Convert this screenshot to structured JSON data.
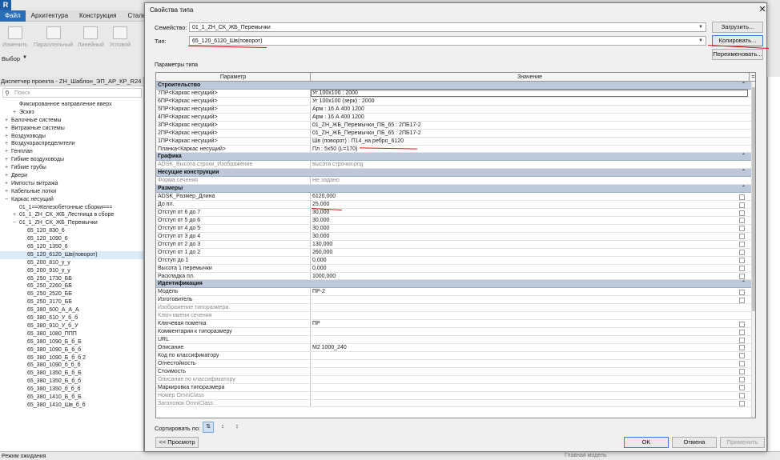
{
  "app": {
    "logo": "R",
    "menu": [
      "Файл",
      "Архитектура",
      "Конструкция",
      "Сталь"
    ],
    "ribbon_tools": [
      "Изменить",
      "Параллельный",
      "Линейный",
      "Угловой"
    ],
    "selection_label": "Выбор",
    "browser_title": "Диспетчер проекта - ZH_Шаблон_ЭП_АР_КР_R24",
    "browser_search_placeholder": "Поиск",
    "tree": [
      {
        "indent": 2,
        "exp": "",
        "label": "Фиксированное направление вверх"
      },
      {
        "indent": 2,
        "exp": "+",
        "label": "Эскиз"
      },
      {
        "indent": 1,
        "exp": "+",
        "label": "Балочные системы"
      },
      {
        "indent": 1,
        "exp": "+",
        "label": "Витражные системы"
      },
      {
        "indent": 1,
        "exp": "+",
        "label": "Воздуховоды"
      },
      {
        "indent": 1,
        "exp": "+",
        "label": "Воздухораспределители"
      },
      {
        "indent": 1,
        "exp": "+",
        "label": "Генплан"
      },
      {
        "indent": 1,
        "exp": "+",
        "label": "Гибкие воздуховоды"
      },
      {
        "indent": 1,
        "exp": "+",
        "label": "Гибкие трубы"
      },
      {
        "indent": 1,
        "exp": "+",
        "label": "Двери"
      },
      {
        "indent": 1,
        "exp": "+",
        "label": "Импосты витража"
      },
      {
        "indent": 1,
        "exp": "+",
        "label": "Кабельные лотки"
      },
      {
        "indent": 1,
        "exp": "−",
        "label": "Каркас несущий"
      },
      {
        "indent": 2,
        "exp": "",
        "label": "01_1==Железобетонные сборки==="
      },
      {
        "indent": 2,
        "exp": "+",
        "label": "01_1_ZH_СК_ЖБ_Лестница в сборе"
      },
      {
        "indent": 2,
        "exp": "−",
        "label": "01_1_ZH_СК_ЖБ_Перемычки"
      },
      {
        "indent": 3,
        "exp": "",
        "label": "65_120_830_6"
      },
      {
        "indent": 3,
        "exp": "",
        "label": "65_120_1090_6"
      },
      {
        "indent": 3,
        "exp": "",
        "label": "65_120_1350_6"
      },
      {
        "indent": 3,
        "exp": "",
        "label": "65_120_6120_Шв(поворот)",
        "selected": true
      },
      {
        "indent": 3,
        "exp": "",
        "label": "65_200_810_у_у"
      },
      {
        "indent": 3,
        "exp": "",
        "label": "65_200_910_у_у"
      },
      {
        "indent": 3,
        "exp": "",
        "label": "65_250_1730_ББ"
      },
      {
        "indent": 3,
        "exp": "",
        "label": "65_250_2260_ББ"
      },
      {
        "indent": 3,
        "exp": "",
        "label": "65_250_2520_ББ"
      },
      {
        "indent": 3,
        "exp": "",
        "label": "65_250_3170_ББ"
      },
      {
        "indent": 3,
        "exp": "",
        "label": "65_380_600_А_А_А"
      },
      {
        "indent": 3,
        "exp": "",
        "label": "65_380_610_У_б_б"
      },
      {
        "indent": 3,
        "exp": "",
        "label": "65_380_910_У_б_У"
      },
      {
        "indent": 3,
        "exp": "",
        "label": "65_380_1080_ППП"
      },
      {
        "indent": 3,
        "exp": "",
        "label": "65_380_1090_Б_б_Б"
      },
      {
        "indent": 3,
        "exp": "",
        "label": "65_380_1090_Б_б_б"
      },
      {
        "indent": 3,
        "exp": "",
        "label": "65_380_1090_Б_б_б 2"
      },
      {
        "indent": 3,
        "exp": "",
        "label": "65_380_1090_б_б_б"
      },
      {
        "indent": 3,
        "exp": "",
        "label": "65_380_1350_Б_б_Б"
      },
      {
        "indent": 3,
        "exp": "",
        "label": "65_380_1350_Б_б_б"
      },
      {
        "indent": 3,
        "exp": "",
        "label": "65_380_1350_б_б_б"
      },
      {
        "indent": 3,
        "exp": "",
        "label": "65_380_1410_Б_б_Б"
      },
      {
        "indent": 3,
        "exp": "",
        "label": "65_380_1410_Шв_б_б"
      }
    ],
    "status_text": "Режим ожидания",
    "status_model": "Главная модель"
  },
  "dialog": {
    "title": "Свойства типа",
    "family_label": "Семейство:",
    "family_value": "01_1_ZH_СК_ЖБ_Перемычки",
    "type_label": "Тип:",
    "type_value": "65_120_6120_Шв(поворот)",
    "load_button": "Загрузить...",
    "copy_button": "Копировать...",
    "rename_button": "Переименовать...",
    "params_label": "Параметры типа",
    "col_param": "Параметр",
    "col_value": "Значение",
    "col_extra": "=",
    "rows": [
      {
        "kind": "group",
        "param": "Строительство"
      },
      {
        "kind": "row",
        "param": "7ПР<Каркас несущий>",
        "value": "Уг 100х100 : 2000",
        "edit": true
      },
      {
        "kind": "row",
        "param": "6ПР<Каркас несущий>",
        "value": "Уг 100х100 (зерк) : 2000"
      },
      {
        "kind": "row",
        "param": "5ПР<Каркас несущий>",
        "value": "Арм : 16 А 400 1200"
      },
      {
        "kind": "row",
        "param": "4ПР<Каркас несущий>",
        "value": "Арм : 16 А 400 1200"
      },
      {
        "kind": "row",
        "param": "3ПР<Каркас несущий>",
        "value": "01_ZH_ЖБ_Перемычки_ПБ_65 : 2ПБ17-2"
      },
      {
        "kind": "row",
        "param": "2ПР<Каркас несущий>",
        "value": "01_ZH_ЖБ_Перемычки_ПБ_65 : 2ПБ17-2"
      },
      {
        "kind": "row",
        "param": "1ПР<Каркас несущий>",
        "value": "Шв (поворот) : П14_на ребро_6120"
      },
      {
        "kind": "row",
        "param": "Планка<Каркас несущий>",
        "value": "Пл : 5х50 (L=170)"
      },
      {
        "kind": "group",
        "param": "Графика"
      },
      {
        "kind": "row",
        "dim": true,
        "param": "ADSK_Высота строки_Изображение",
        "value": "высота строчки.png"
      },
      {
        "kind": "group",
        "param": "Несущие конструкции"
      },
      {
        "kind": "row",
        "dim": true,
        "param": "Форма сечения",
        "value": "Не задано"
      },
      {
        "kind": "group",
        "param": "Размеры"
      },
      {
        "kind": "row",
        "param": "ADSK_Размер_Длина",
        "value": "6120,000",
        "chk": true
      },
      {
        "kind": "row",
        "param": "До пл.",
        "value": "25,000",
        "chk": true
      },
      {
        "kind": "row",
        "param": "Отступ от 6 до 7",
        "value": "30,000",
        "chk": true
      },
      {
        "kind": "row",
        "param": "Отступ от 5 до 6",
        "value": "30,000",
        "chk": true
      },
      {
        "kind": "row",
        "param": "Отступ от 4 до 5",
        "value": "30,000",
        "chk": true
      },
      {
        "kind": "row",
        "param": "Отступ от 3 до 4",
        "value": "30,000",
        "chk": true
      },
      {
        "kind": "row",
        "param": "Отступ от 2 до 3",
        "value": "130,000",
        "chk": true
      },
      {
        "kind": "row",
        "param": "Отступ от 1 до 2",
        "value": "260,000",
        "chk": true
      },
      {
        "kind": "row",
        "param": "Отступ до 1",
        "value": "0,000",
        "chk": true
      },
      {
        "kind": "row",
        "param": "Высота 1 перемычки",
        "value": "0,000",
        "chk": true
      },
      {
        "kind": "row",
        "param": "Раскладка пл.",
        "value": "1000,000",
        "chk": true
      },
      {
        "kind": "group",
        "param": "Идентификация"
      },
      {
        "kind": "row",
        "param": "Модель",
        "value": "ПР-2",
        "chk": true
      },
      {
        "kind": "row",
        "param": "Изготовитель",
        "value": "",
        "chk": true
      },
      {
        "kind": "row",
        "dim": true,
        "param": "Изображение типоразмера",
        "value": ""
      },
      {
        "kind": "row",
        "dim": true,
        "param": "Ключ имени сечения",
        "value": ""
      },
      {
        "kind": "row",
        "param": "Ключевая пометка",
        "value": "ПР",
        "chk": true
      },
      {
        "kind": "row",
        "param": "Комментарии к типоразмеру",
        "value": "",
        "chk": true
      },
      {
        "kind": "row",
        "param": "URL",
        "value": "",
        "chk": true
      },
      {
        "kind": "row",
        "param": "Описание",
        "value": "М2 1000_240",
        "chk": true
      },
      {
        "kind": "row",
        "param": "Код по классификатору",
        "value": "",
        "chk": true
      },
      {
        "kind": "row",
        "param": "Огнестойкость",
        "value": "",
        "chk": true
      },
      {
        "kind": "row",
        "param": "Стоимость",
        "value": "",
        "chk": true
      },
      {
        "kind": "row",
        "dim": true,
        "param": "Описание по классификатору",
        "value": "",
        "chk": true
      },
      {
        "kind": "row",
        "param": "Маркировка типоразмера",
        "value": "",
        "chk": true
      },
      {
        "kind": "row",
        "dim": true,
        "param": "Номер OmniClass",
        "value": "",
        "chk": true
      },
      {
        "kind": "row",
        "dim": true,
        "param": "Заголовок OmniClass",
        "value": "",
        "chk": true
      }
    ],
    "sort_label": "Сортировать по:",
    "preview_button": "<< Просмотр",
    "ok_button": "OK",
    "cancel_button": "Отмена",
    "apply_button": "Применить"
  },
  "colors": {
    "accent": "#2a6fb6",
    "group_header": "#bcc9db",
    "annotation_red": "#dd1111"
  }
}
